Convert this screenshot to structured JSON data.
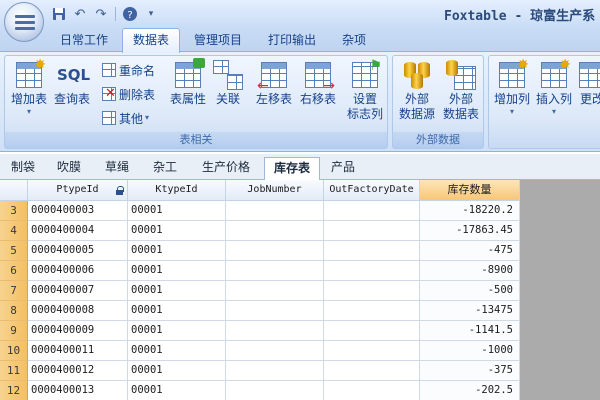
{
  "window": {
    "title": "Foxtable - 琼富生产系"
  },
  "quick_access": [
    "save-icon",
    "undo-icon",
    "redo-icon",
    "help-icon",
    "dropdown-icon"
  ],
  "ribbon_tabs": [
    {
      "label": "日常工作",
      "active": false
    },
    {
      "label": "数据表",
      "active": true
    },
    {
      "label": "管理项目",
      "active": false
    },
    {
      "label": "打印输出",
      "active": false
    },
    {
      "label": "杂项",
      "active": false
    }
  ],
  "ribbon": {
    "group_table": {
      "label": "表相关",
      "add_table": "增加表",
      "query_table": "查询表",
      "rename": "重命名",
      "delete_table": "删除表",
      "other": "其他",
      "table_props": "表属性",
      "relation": "关联",
      "move_left": "左移表",
      "move_right": "右移表",
      "set_flag_1": "设置",
      "set_flag_2": "标志列"
    },
    "group_external": {
      "label": "外部数据",
      "ext_source_1": "外部",
      "ext_source_2": "数据源",
      "ext_table_1": "外部",
      "ext_table_2": "数据表"
    },
    "group_columns": {
      "add_col": "增加列",
      "insert_col": "插入列",
      "change_col": "更改"
    }
  },
  "sheet_tabs": [
    {
      "label": "制袋",
      "active": false
    },
    {
      "label": "吹膜",
      "active": false
    },
    {
      "label": "草绳",
      "active": false
    },
    {
      "label": "杂工",
      "active": false
    },
    {
      "label": "生产价格",
      "active": false
    },
    {
      "label": "库存表",
      "active": true
    },
    {
      "label": "产品",
      "active": false
    }
  ],
  "table": {
    "columns": [
      "PtypeId",
      "KtypeId",
      "JobNumber",
      "OutFactoryDate",
      "库存数量"
    ],
    "rows": [
      {
        "n": "3",
        "ptype": "0000400003",
        "ktype": "00001",
        "job": "",
        "date": "",
        "qty": "-18220.2"
      },
      {
        "n": "4",
        "ptype": "0000400004",
        "ktype": "00001",
        "job": "",
        "date": "",
        "qty": "-17863.45"
      },
      {
        "n": "5",
        "ptype": "0000400005",
        "ktype": "00001",
        "job": "",
        "date": "",
        "qty": "-475"
      },
      {
        "n": "6",
        "ptype": "0000400006",
        "ktype": "00001",
        "job": "",
        "date": "",
        "qty": "-8900"
      },
      {
        "n": "7",
        "ptype": "0000400007",
        "ktype": "00001",
        "job": "",
        "date": "",
        "qty": "-500"
      },
      {
        "n": "8",
        "ptype": "0000400008",
        "ktype": "00001",
        "job": "",
        "date": "",
        "qty": "-13475"
      },
      {
        "n": "9",
        "ptype": "0000400009",
        "ktype": "00001",
        "job": "",
        "date": "",
        "qty": "-1141.5"
      },
      {
        "n": "10",
        "ptype": "0000400011",
        "ktype": "00001",
        "job": "",
        "date": "",
        "qty": "-1000"
      },
      {
        "n": "11",
        "ptype": "0000400012",
        "ktype": "00001",
        "job": "",
        "date": "",
        "qty": "-375"
      },
      {
        "n": "12",
        "ptype": "0000400013",
        "ktype": "00001",
        "job": "",
        "date": "",
        "qty": "-202.5"
      }
    ]
  },
  "colors": {
    "ribbon_blue": "#dae7f8",
    "selected_header": "#f8c676",
    "row_header": "#f4bf63",
    "empty_area": "#ababab"
  }
}
